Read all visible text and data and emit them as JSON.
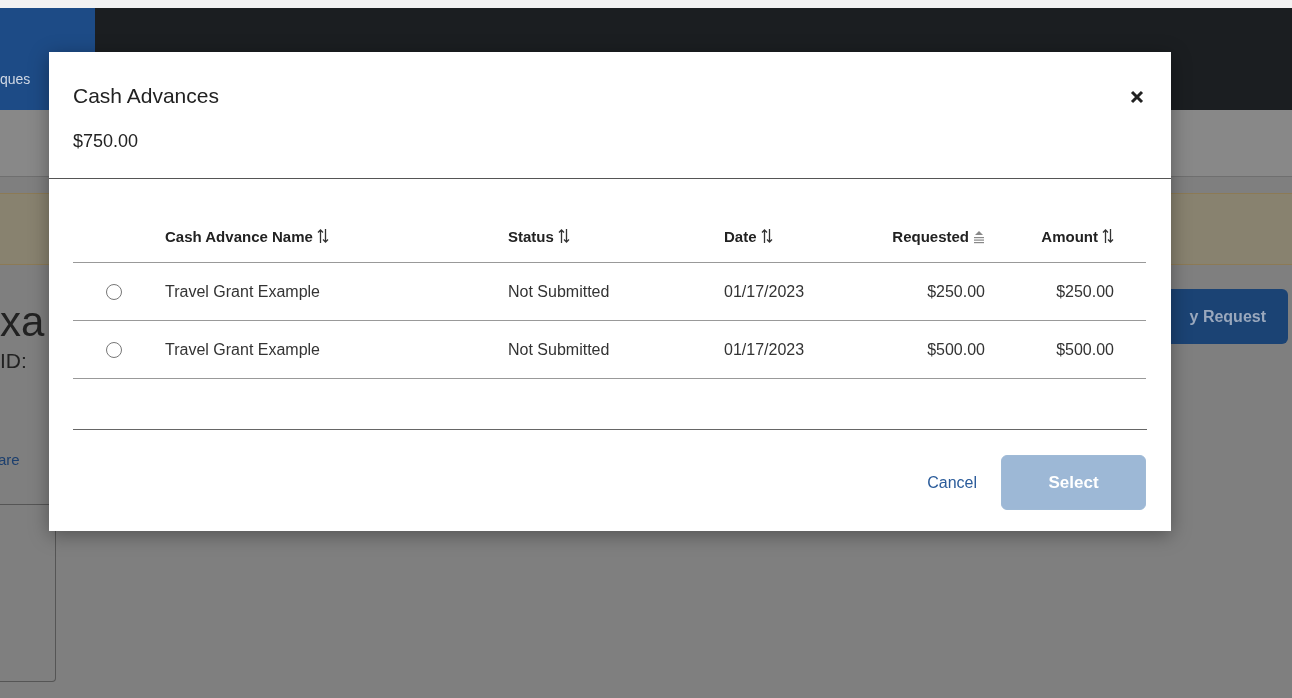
{
  "background": {
    "nav_tab": {
      "label": "ques",
      "selected": true
    },
    "heading": "xa",
    "id_label": "ID:",
    "share_link": "are",
    "request_button": "y Request"
  },
  "dialog": {
    "title": "Cash Advances",
    "total": "$750.00",
    "columns": [
      {
        "label": "Cash Advance Name",
        "sorted": false
      },
      {
        "label": "Status",
        "sorted": false
      },
      {
        "label": "Date",
        "sorted": false
      },
      {
        "label": "Requested",
        "sorted": true
      },
      {
        "label": "Amount",
        "sorted": false
      }
    ],
    "rows": [
      {
        "selected": false,
        "cells": [
          "Travel Grant Example",
          "Not Submitted",
          "01/17/2023",
          "$250.00",
          "$250.00"
        ]
      },
      {
        "selected": false,
        "cells": [
          "Travel Grant Example",
          "Not Submitted",
          "01/17/2023",
          "$500.00",
          "$500.00"
        ]
      }
    ],
    "cancel": "Cancel",
    "select": {
      "label": "Select",
      "disabled": true
    }
  }
}
